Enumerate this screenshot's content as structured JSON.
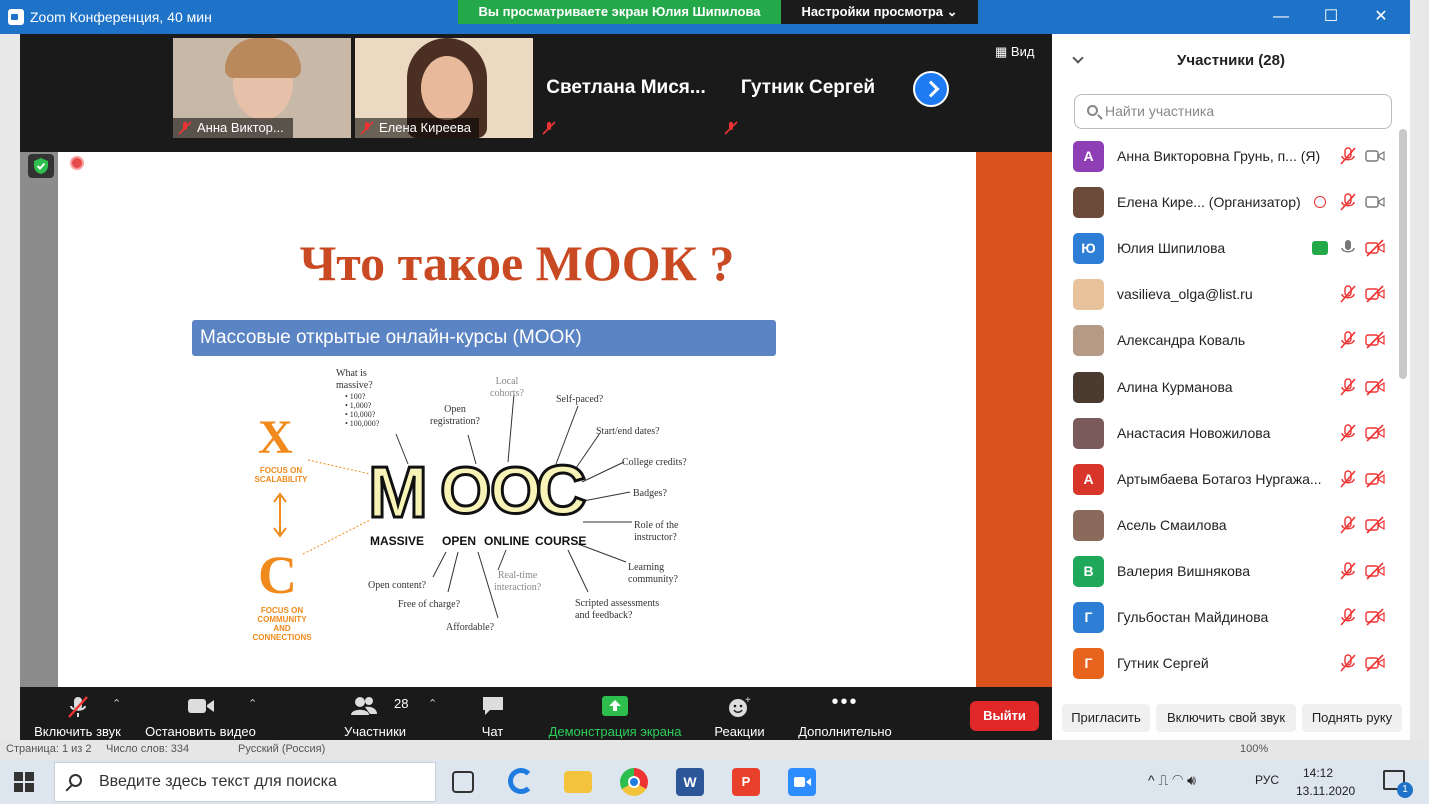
{
  "window": {
    "title": "Zoom Конференция, 40 мин",
    "share_banner": "Вы просматриваете экран Юлия Шипилова",
    "view_settings": "Настройки просмотра ⌄"
  },
  "videostrip": {
    "view_label": "Вид",
    "tiles": [
      {
        "name": "Анна Виктор..."
      },
      {
        "name": "Елена Киреева"
      },
      {
        "name": "Светлана  Мися..."
      },
      {
        "name": "Гутник Сергей"
      }
    ]
  },
  "slide": {
    "title": "Что такое МООК ?",
    "banner": "Массовые открытые онлайн-курсы (МООК)",
    "letters": [
      "M",
      "O",
      "O",
      "C"
    ],
    "words": [
      "MASSIVE",
      "OPEN",
      "ONLINE",
      "COURSE"
    ],
    "labels": {
      "what_is": "What is",
      "massive": "massive?",
      "opts": [
        "• 100?",
        "• 1,000?",
        "• 10,000?",
        "• 100,000?"
      ],
      "open_reg_1": "Open",
      "open_reg_2": "registration?",
      "local_1": "Local",
      "local_2": "cohorts?",
      "self_paced": "Self-paced?",
      "start_end": "Start/end dates?",
      "college": "College credits?",
      "badges": "Badges?",
      "role_1": "Role of the",
      "role_2": "instructor?",
      "learning_1": "Learning",
      "learning_2": "community?",
      "scripted_1": "Scripted assessments",
      "scripted_2": "and feedback?",
      "realtime_1": "Real-time",
      "realtime_2": "interaction?",
      "open_content": "Open content?",
      "free": "Free of charge?",
      "affordable": "Affordable?"
    },
    "x_letter": "X",
    "c_letter": "C",
    "focus_scal_1": "FOCUS ON",
    "focus_scal_2": "SCALABILITY",
    "focus_comm_1": "FOCUS ON",
    "focus_comm_2": "COMMUNITY",
    "focus_comm_3": "AND CONNECTIONS"
  },
  "toolbar": {
    "audio": "Включить звук",
    "video": "Остановить видео",
    "participants": "Участники",
    "participants_count": "28",
    "chat": "Чат",
    "share": "Демонстрация экрана",
    "reactions": "Реакции",
    "more": "Дополнительно",
    "leave": "Выйти"
  },
  "panel": {
    "title": "Участники (28)",
    "search_placeholder": "Найти участника",
    "participants": [
      {
        "name": "Анна Викторовна Грунь, п...  (Я)",
        "initial": "А",
        "color": "#8e3fb5"
      },
      {
        "name": "Елена Кире...  (Организатор)",
        "initial": "",
        "color": "#6b4a3a"
      },
      {
        "name": "Юлия Шипилова",
        "initial": "Ю",
        "color": "#2d7fd6"
      },
      {
        "name": "vasilieva_olga@list.ru",
        "initial": "",
        "color": "#e8c29a"
      },
      {
        "name": "Александра Коваль",
        "initial": "",
        "color": "#b59a86"
      },
      {
        "name": "Алина Курманова",
        "initial": "",
        "color": "#4a3a30"
      },
      {
        "name": "Анастасия Новожилова",
        "initial": "",
        "color": "#7a5a5a"
      },
      {
        "name": "Артымбаева Ботагоз Нургажа...",
        "initial": "А",
        "color": "#d9362b"
      },
      {
        "name": "Асель Смаилова",
        "initial": "",
        "color": "#8a6a5a"
      },
      {
        "name": "Валерия Вишнякова",
        "initial": "В",
        "color": "#1fa85a"
      },
      {
        "name": "Гульбостан Майдинова",
        "initial": "Г",
        "color": "#2d7fd6"
      },
      {
        "name": "Гутник Сергей",
        "initial": "Г",
        "color": "#e8641e"
      }
    ],
    "invite": "Пригласить",
    "unmute_me": "Включить свой звук",
    "raise_hand": "Поднять руку"
  },
  "wordstatus": {
    "page": "Страница: 1 из 2",
    "words": "Число слов: 334",
    "lang": "Русский (Россия)",
    "zoom": "100%"
  },
  "taskbar": {
    "search_placeholder": "Введите здесь текст для поиска",
    "lang": "РУС",
    "time": "14:12",
    "date": "13.11.2020",
    "notif": "1"
  }
}
